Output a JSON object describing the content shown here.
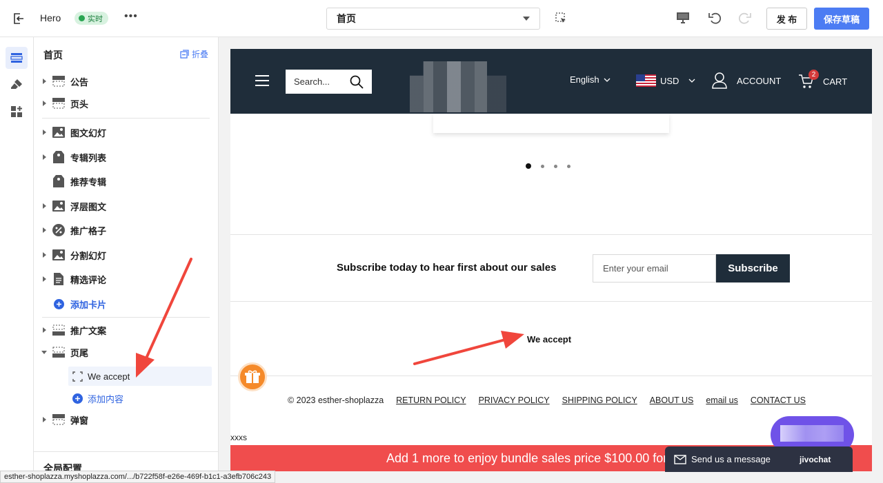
{
  "topbar": {
    "title": "Hero",
    "badge": "实时",
    "more": "•••",
    "page_selector": "首页",
    "publish_label": "发 布",
    "save_label": "保存草稿"
  },
  "panel": {
    "heading": "首页",
    "collapse_label": "折叠",
    "items": [
      {
        "label": "公告"
      },
      {
        "label": "页头"
      },
      {
        "label": "图文幻灯"
      },
      {
        "label": "专辑列表"
      },
      {
        "label": "推荐专辑"
      },
      {
        "label": "浮层图文"
      },
      {
        "label": "推广格子"
      },
      {
        "label": "分割幻灯"
      },
      {
        "label": "精选评论"
      },
      {
        "label": "添加卡片"
      },
      {
        "label": "推广文案"
      },
      {
        "label": "页尾"
      },
      {
        "label": "We accept"
      },
      {
        "label": "添加内容"
      },
      {
        "label": "弹窗"
      }
    ],
    "global_config": "全局配置"
  },
  "preview": {
    "search_placeholder": "Search...",
    "language": "English",
    "currency": "USD",
    "account": "ACCOUNT",
    "cart": "CART",
    "cart_count": "2",
    "subscribe_text": "Subscribe today to hear first about our sales",
    "email_placeholder": "Enter your email",
    "subscribe_button": "Subscribe",
    "we_accept": "We accept",
    "copyright": "© 2023 esther-shoplazza",
    "footer_links": [
      "RETURN POLICY",
      "PRIVACY POLICY",
      "SHIPPING POLICY",
      "ABOUT US",
      "email us",
      "CONTACT US"
    ],
    "xxxs": "xxxs",
    "promo": "Add 1 more to enjoy bundle sales price $100.00 for"
  },
  "chat": {
    "message": "Send us a message",
    "brand": "jivochat"
  },
  "statusbar": "esther-shoplazza.myshoplazza.com/.../b722f58f-e26e-469f-b1c1-a3efb706c243",
  "colors": {
    "accent": "#4c7cf3",
    "header_dark": "#1f2d3a",
    "promo_red": "#f04d4d",
    "annotation_red": "#f0463c"
  },
  "icons": [
    "exit-icon",
    "select-element-icon",
    "desktop-icon",
    "undo-icon",
    "redo-icon",
    "sections-icon",
    "theme-brush-icon",
    "apps-icon",
    "collapse-icon",
    "hamburger-icon",
    "search-icon",
    "chevron-down-icon",
    "us-flag-icon",
    "account-icon",
    "cart-icon",
    "gift-icon",
    "envelope-icon"
  ]
}
